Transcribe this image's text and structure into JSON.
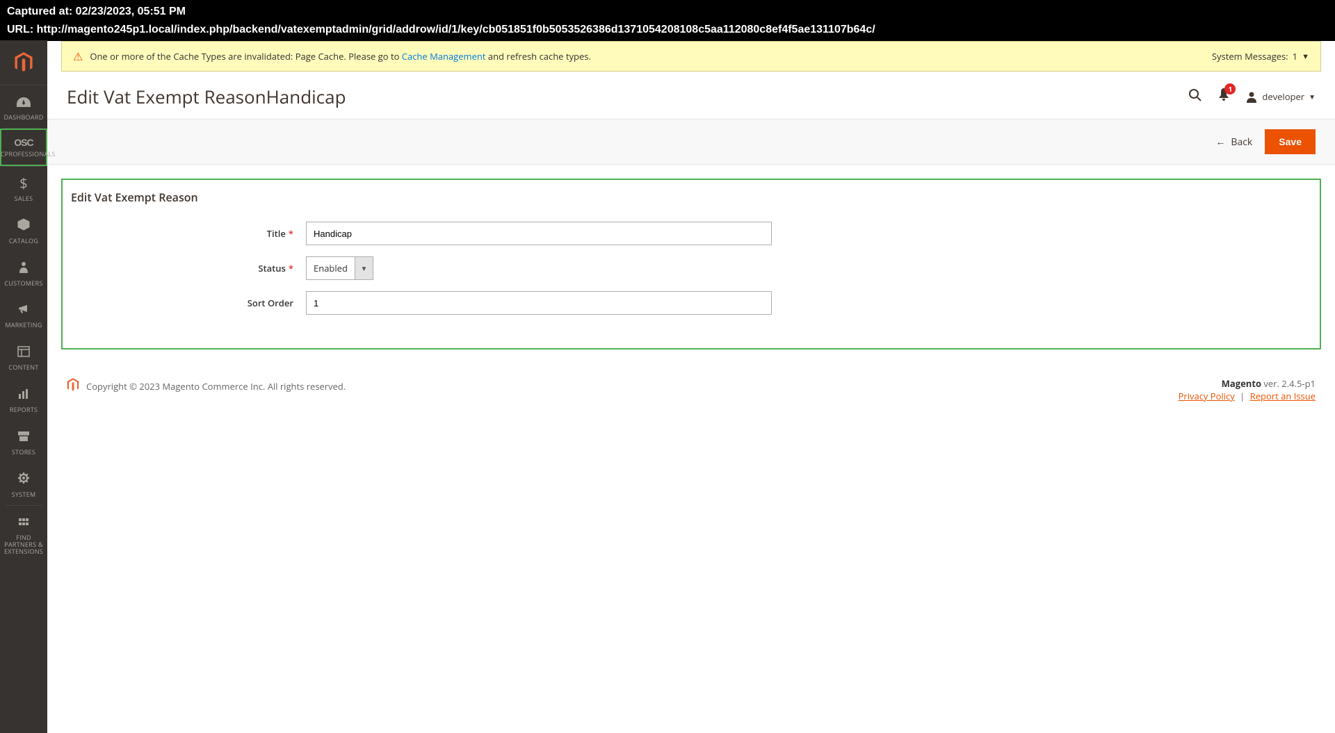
{
  "topbar": {
    "captured_label": "Captured at: 02/23/2023, 05:51 PM",
    "url_label": "URL: http://magento245p1.local/index.php/backend/vatexemptadmin/grid/addrow/id/1/key/cb051851f0b5053526386d1371054208108c5aa112080c8ef4f5ae131107b64c/"
  },
  "sidebar": {
    "items": [
      {
        "label": "DASHBOARD"
      },
      {
        "label": "OSCPROFESSIONALS"
      },
      {
        "label": "SALES"
      },
      {
        "label": "CATALOG"
      },
      {
        "label": "CUSTOMERS"
      },
      {
        "label": "MARKETING"
      },
      {
        "label": "CONTENT"
      },
      {
        "label": "REPORTS"
      },
      {
        "label": "STORES"
      },
      {
        "label": "SYSTEM"
      },
      {
        "label": "FIND PARTNERS & EXTENSIONS"
      }
    ]
  },
  "sysmsg": {
    "text_before": "One or more of the Cache Types are invalidated: Page Cache. Please go to ",
    "link": "Cache Management",
    "text_after": " and refresh cache types.",
    "right_label": "System Messages:",
    "right_count": "1"
  },
  "header": {
    "title": "Edit Vat Exempt ReasonHandicap",
    "notification_count": "1",
    "user": "developer"
  },
  "actions": {
    "back": "Back",
    "save": "Save"
  },
  "form": {
    "panel_title": "Edit Vat Exempt Reason",
    "title_label": "Title",
    "title_value": "Handicap",
    "status_label": "Status",
    "status_value": "Enabled",
    "sort_label": "Sort Order",
    "sort_value": "1"
  },
  "footer": {
    "copyright": "Copyright © 2023 Magento Commerce Inc. All rights reserved.",
    "version_prefix": "Magento",
    "version": " ver. 2.4.5-p1",
    "privacy": "Privacy Policy",
    "report": "Report an Issue"
  }
}
